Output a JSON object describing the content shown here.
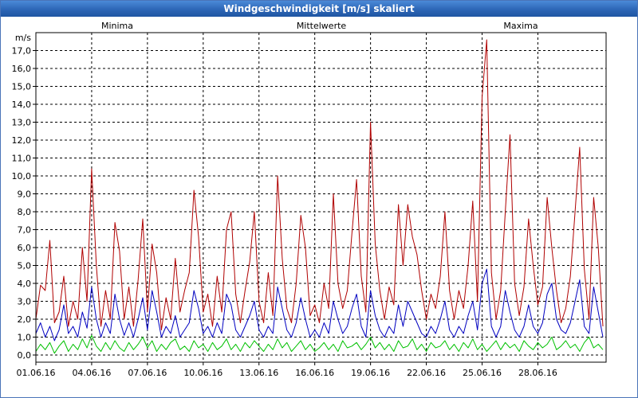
{
  "window": {
    "title": "Windgeschwindigkeit [m/s] skaliert"
  },
  "chart_data": {
    "type": "line",
    "title": "Windgeschwindigkeit [m/s] skaliert",
    "ylabel": "m/s",
    "xlabel": "",
    "ylim": [
      -0.4,
      18.0
    ],
    "xlim": [
      0,
      30.67
    ],
    "grid": true,
    "legend_position": "top",
    "x_tick_values": [
      0,
      3,
      6,
      9,
      12,
      15,
      18,
      21,
      24,
      27
    ],
    "x_tick_labels": [
      "01.06.16",
      "04.06.16",
      "07.06.16",
      "10.06.16",
      "13.06.16",
      "16.06.16",
      "19.06.16",
      "22.06.16",
      "25.06.16",
      "28.06.16"
    ],
    "y_tick_values": [
      0,
      1,
      2,
      3,
      4,
      5,
      6,
      7,
      8,
      9,
      10,
      11,
      12,
      13,
      14,
      15,
      16,
      17
    ],
    "y_tick_labels": [
      "0,0",
      "1,0",
      "2,0",
      "3,0",
      "4,0",
      "5,0",
      "6,0",
      "7,0",
      "8,0",
      "9,0",
      "10,0",
      "11,0",
      "12,0",
      "13,0",
      "14,0",
      "15,0",
      "16,0",
      "17,0"
    ],
    "series": [
      {
        "name": "Minima",
        "color": "#00c000",
        "x": [
          0.0,
          0.25,
          0.5,
          0.75,
          1.0,
          1.25,
          1.5,
          1.75,
          2.0,
          2.25,
          2.5,
          2.75,
          3.0,
          3.25,
          3.5,
          3.75,
          4.0,
          4.25,
          4.5,
          4.75,
          5.0,
          5.25,
          5.5,
          5.75,
          6.0,
          6.25,
          6.5,
          6.75,
          7.0,
          7.25,
          7.5,
          7.75,
          8.0,
          8.25,
          8.5,
          8.75,
          9.0,
          9.25,
          9.5,
          9.75,
          10.0,
          10.25,
          10.5,
          10.75,
          11.0,
          11.25,
          11.5,
          11.75,
          12.0,
          12.25,
          12.5,
          12.75,
          13.0,
          13.25,
          13.5,
          13.75,
          14.0,
          14.25,
          14.5,
          14.75,
          15.0,
          15.25,
          15.5,
          15.75,
          16.0,
          16.25,
          16.5,
          16.75,
          17.0,
          17.25,
          17.5,
          17.75,
          18.0,
          18.25,
          18.5,
          18.75,
          19.0,
          19.25,
          19.5,
          19.75,
          20.0,
          20.25,
          20.5,
          20.75,
          21.0,
          21.25,
          21.5,
          21.75,
          22.0,
          22.25,
          22.5,
          22.75,
          23.0,
          23.25,
          23.5,
          23.75,
          24.0,
          24.25,
          24.5,
          24.75,
          25.0,
          25.25,
          25.5,
          25.75,
          26.0,
          26.25,
          26.5,
          26.75,
          27.0,
          27.25,
          27.5,
          27.75,
          28.0,
          28.25,
          28.5,
          28.75,
          29.0,
          29.25,
          29.5,
          29.75,
          30.0,
          30.25,
          30.5
        ],
        "values": [
          0.2,
          0.6,
          0.3,
          0.7,
          0.1,
          0.5,
          0.8,
          0.2,
          0.6,
          0.3,
          0.9,
          0.4,
          1.1,
          0.5,
          0.2,
          0.7,
          0.3,
          0.8,
          0.4,
          0.2,
          0.7,
          0.3,
          0.6,
          1.0,
          0.4,
          0.8,
          0.2,
          0.6,
          0.3,
          0.7,
          0.9,
          0.3,
          0.5,
          0.2,
          0.8,
          0.4,
          0.6,
          0.2,
          0.7,
          0.3,
          0.5,
          0.9,
          0.3,
          0.6,
          0.2,
          0.7,
          0.4,
          0.8,
          0.5,
          0.2,
          0.6,
          0.3,
          0.9,
          0.4,
          0.7,
          0.2,
          0.5,
          0.8,
          0.3,
          0.6,
          0.2,
          0.4,
          0.7,
          0.3,
          0.6,
          0.2,
          0.8,
          0.4,
          0.5,
          0.7,
          0.3,
          0.6,
          1.0,
          0.4,
          0.7,
          0.3,
          0.6,
          0.2,
          0.8,
          0.4,
          0.5,
          0.9,
          0.3,
          0.6,
          0.2,
          0.7,
          0.4,
          0.5,
          0.8,
          0.3,
          0.6,
          0.2,
          0.7,
          0.4,
          0.9,
          0.3,
          0.6,
          0.2,
          0.5,
          0.8,
          0.3,
          0.7,
          0.4,
          0.6,
          0.2,
          0.8,
          0.5,
          0.3,
          0.7,
          0.4,
          0.6,
          1.0,
          0.3,
          0.5,
          0.8,
          0.4,
          0.6,
          0.2,
          0.7,
          1.0,
          0.4,
          0.6,
          0.3
        ]
      },
      {
        "name": "Mittelwerte",
        "color": "#0000c0",
        "x": [
          0.0,
          0.25,
          0.5,
          0.75,
          1.0,
          1.25,
          1.5,
          1.75,
          2.0,
          2.25,
          2.5,
          2.75,
          3.0,
          3.25,
          3.5,
          3.75,
          4.0,
          4.25,
          4.5,
          4.75,
          5.0,
          5.25,
          5.5,
          5.75,
          6.0,
          6.25,
          6.5,
          6.75,
          7.0,
          7.25,
          7.5,
          7.75,
          8.0,
          8.25,
          8.5,
          8.75,
          9.0,
          9.25,
          9.5,
          9.75,
          10.0,
          10.25,
          10.5,
          10.75,
          11.0,
          11.25,
          11.5,
          11.75,
          12.0,
          12.25,
          12.5,
          12.75,
          13.0,
          13.25,
          13.5,
          13.75,
          14.0,
          14.25,
          14.5,
          14.75,
          15.0,
          15.25,
          15.5,
          15.75,
          16.0,
          16.25,
          16.5,
          16.75,
          17.0,
          17.25,
          17.5,
          17.75,
          18.0,
          18.25,
          18.5,
          18.75,
          19.0,
          19.25,
          19.5,
          19.75,
          20.0,
          20.25,
          20.5,
          20.75,
          21.0,
          21.25,
          21.5,
          21.75,
          22.0,
          22.25,
          22.5,
          22.75,
          23.0,
          23.25,
          23.5,
          23.75,
          24.0,
          24.25,
          24.5,
          24.75,
          25.0,
          25.25,
          25.5,
          25.75,
          26.0,
          26.25,
          26.5,
          26.75,
          27.0,
          27.25,
          27.5,
          27.75,
          28.0,
          28.25,
          28.5,
          28.75,
          29.0,
          29.25,
          29.5,
          29.75,
          30.0,
          30.25,
          30.5
        ],
        "values": [
          1.2,
          1.8,
          1.0,
          1.6,
          0.8,
          1.4,
          2.8,
          1.2,
          1.6,
          1.0,
          2.4,
          1.5,
          3.8,
          2.0,
          1.0,
          1.8,
          1.2,
          3.4,
          2.0,
          1.1,
          1.8,
          1.0,
          2.0,
          3.2,
          1.4,
          3.6,
          2.4,
          1.0,
          1.6,
          1.2,
          2.2,
          1.0,
          1.4,
          1.8,
          3.6,
          2.6,
          1.2,
          1.6,
          1.0,
          1.8,
          1.2,
          3.4,
          2.8,
          1.4,
          1.0,
          1.6,
          2.2,
          3.0,
          1.4,
          1.0,
          1.6,
          1.2,
          3.8,
          2.6,
          1.4,
          1.0,
          1.8,
          3.2,
          2.0,
          1.0,
          1.4,
          1.0,
          1.8,
          1.2,
          3.0,
          2.0,
          1.2,
          1.6,
          2.6,
          3.4,
          1.6,
          1.0,
          3.6,
          2.2,
          1.4,
          1.0,
          1.6,
          1.2,
          2.8,
          1.6,
          3.0,
          2.4,
          1.8,
          1.2,
          1.0,
          1.6,
          1.2,
          2.0,
          3.0,
          1.4,
          1.0,
          1.6,
          1.2,
          2.2,
          3.0,
          1.4,
          4.0,
          4.8,
          1.6,
          1.0,
          1.6,
          3.6,
          2.4,
          1.4,
          1.0,
          1.6,
          2.8,
          1.6,
          1.2,
          1.8,
          3.4,
          4.0,
          2.0,
          1.4,
          1.2,
          1.8,
          3.0,
          4.2,
          1.6,
          1.2,
          3.8,
          2.4,
          1.0
        ]
      },
      {
        "name": "Maxima",
        "color": "#b00000",
        "x": [
          0.0,
          0.25,
          0.5,
          0.75,
          1.0,
          1.25,
          1.5,
          1.75,
          2.0,
          2.25,
          2.5,
          2.75,
          3.0,
          3.25,
          3.5,
          3.75,
          4.0,
          4.25,
          4.5,
          4.75,
          5.0,
          5.25,
          5.5,
          5.75,
          6.0,
          6.25,
          6.5,
          6.75,
          7.0,
          7.25,
          7.5,
          7.75,
          8.0,
          8.25,
          8.5,
          8.75,
          9.0,
          9.25,
          9.5,
          9.75,
          10.0,
          10.25,
          10.5,
          10.75,
          11.0,
          11.25,
          11.5,
          11.75,
          12.0,
          12.25,
          12.5,
          12.75,
          13.0,
          13.25,
          13.5,
          13.75,
          14.0,
          14.25,
          14.5,
          14.75,
          15.0,
          15.25,
          15.5,
          15.75,
          16.0,
          16.25,
          16.5,
          16.75,
          17.0,
          17.25,
          17.5,
          17.75,
          18.0,
          18.25,
          18.5,
          18.75,
          19.0,
          19.25,
          19.5,
          19.75,
          20.0,
          20.25,
          20.5,
          20.75,
          21.0,
          21.25,
          21.5,
          21.75,
          22.0,
          22.25,
          22.5,
          22.75,
          23.0,
          23.25,
          23.5,
          23.75,
          24.0,
          24.25,
          24.5,
          24.75,
          25.0,
          25.25,
          25.5,
          25.75,
          26.0,
          26.25,
          26.5,
          26.75,
          27.0,
          27.25,
          27.5,
          27.75,
          28.0,
          28.25,
          28.5,
          28.75,
          29.0,
          29.25,
          29.5,
          29.75,
          30.0,
          30.25,
          30.5
        ],
        "values": [
          2.0,
          3.9,
          3.6,
          6.4,
          1.8,
          2.4,
          4.4,
          1.6,
          3.0,
          2.0,
          6.0,
          3.0,
          10.4,
          5.0,
          1.6,
          3.6,
          2.0,
          7.4,
          5.8,
          2.0,
          3.8,
          1.6,
          4.2,
          7.6,
          2.4,
          6.2,
          4.6,
          1.4,
          3.2,
          2.0,
          5.4,
          2.4,
          3.6,
          4.6,
          9.2,
          6.6,
          2.4,
          3.4,
          1.6,
          4.4,
          2.4,
          7.0,
          8.0,
          3.4,
          1.8,
          3.6,
          5.2,
          8.0,
          3.0,
          1.8,
          4.6,
          2.2,
          10.0,
          5.4,
          2.6,
          1.8,
          4.0,
          7.8,
          6.0,
          2.2,
          2.8,
          1.8,
          4.0,
          2.6,
          9.0,
          4.0,
          2.6,
          3.6,
          6.8,
          9.8,
          4.4,
          2.4,
          13.0,
          6.2,
          3.6,
          2.0,
          3.8,
          2.8,
          8.4,
          5.0,
          8.4,
          6.6,
          5.6,
          3.6,
          2.0,
          3.4,
          2.6,
          4.4,
          8.0,
          3.6,
          2.0,
          3.6,
          2.6,
          5.0,
          8.6,
          3.0,
          14.4,
          17.6,
          4.6,
          2.0,
          3.6,
          8.0,
          12.3,
          4.0,
          2.2,
          3.8,
          7.6,
          5.0,
          2.8,
          3.8,
          8.8,
          6.0,
          3.6,
          1.8,
          2.6,
          4.4,
          8.0,
          11.6,
          4.8,
          2.0,
          8.8,
          6.0,
          1.6
        ]
      }
    ]
  }
}
